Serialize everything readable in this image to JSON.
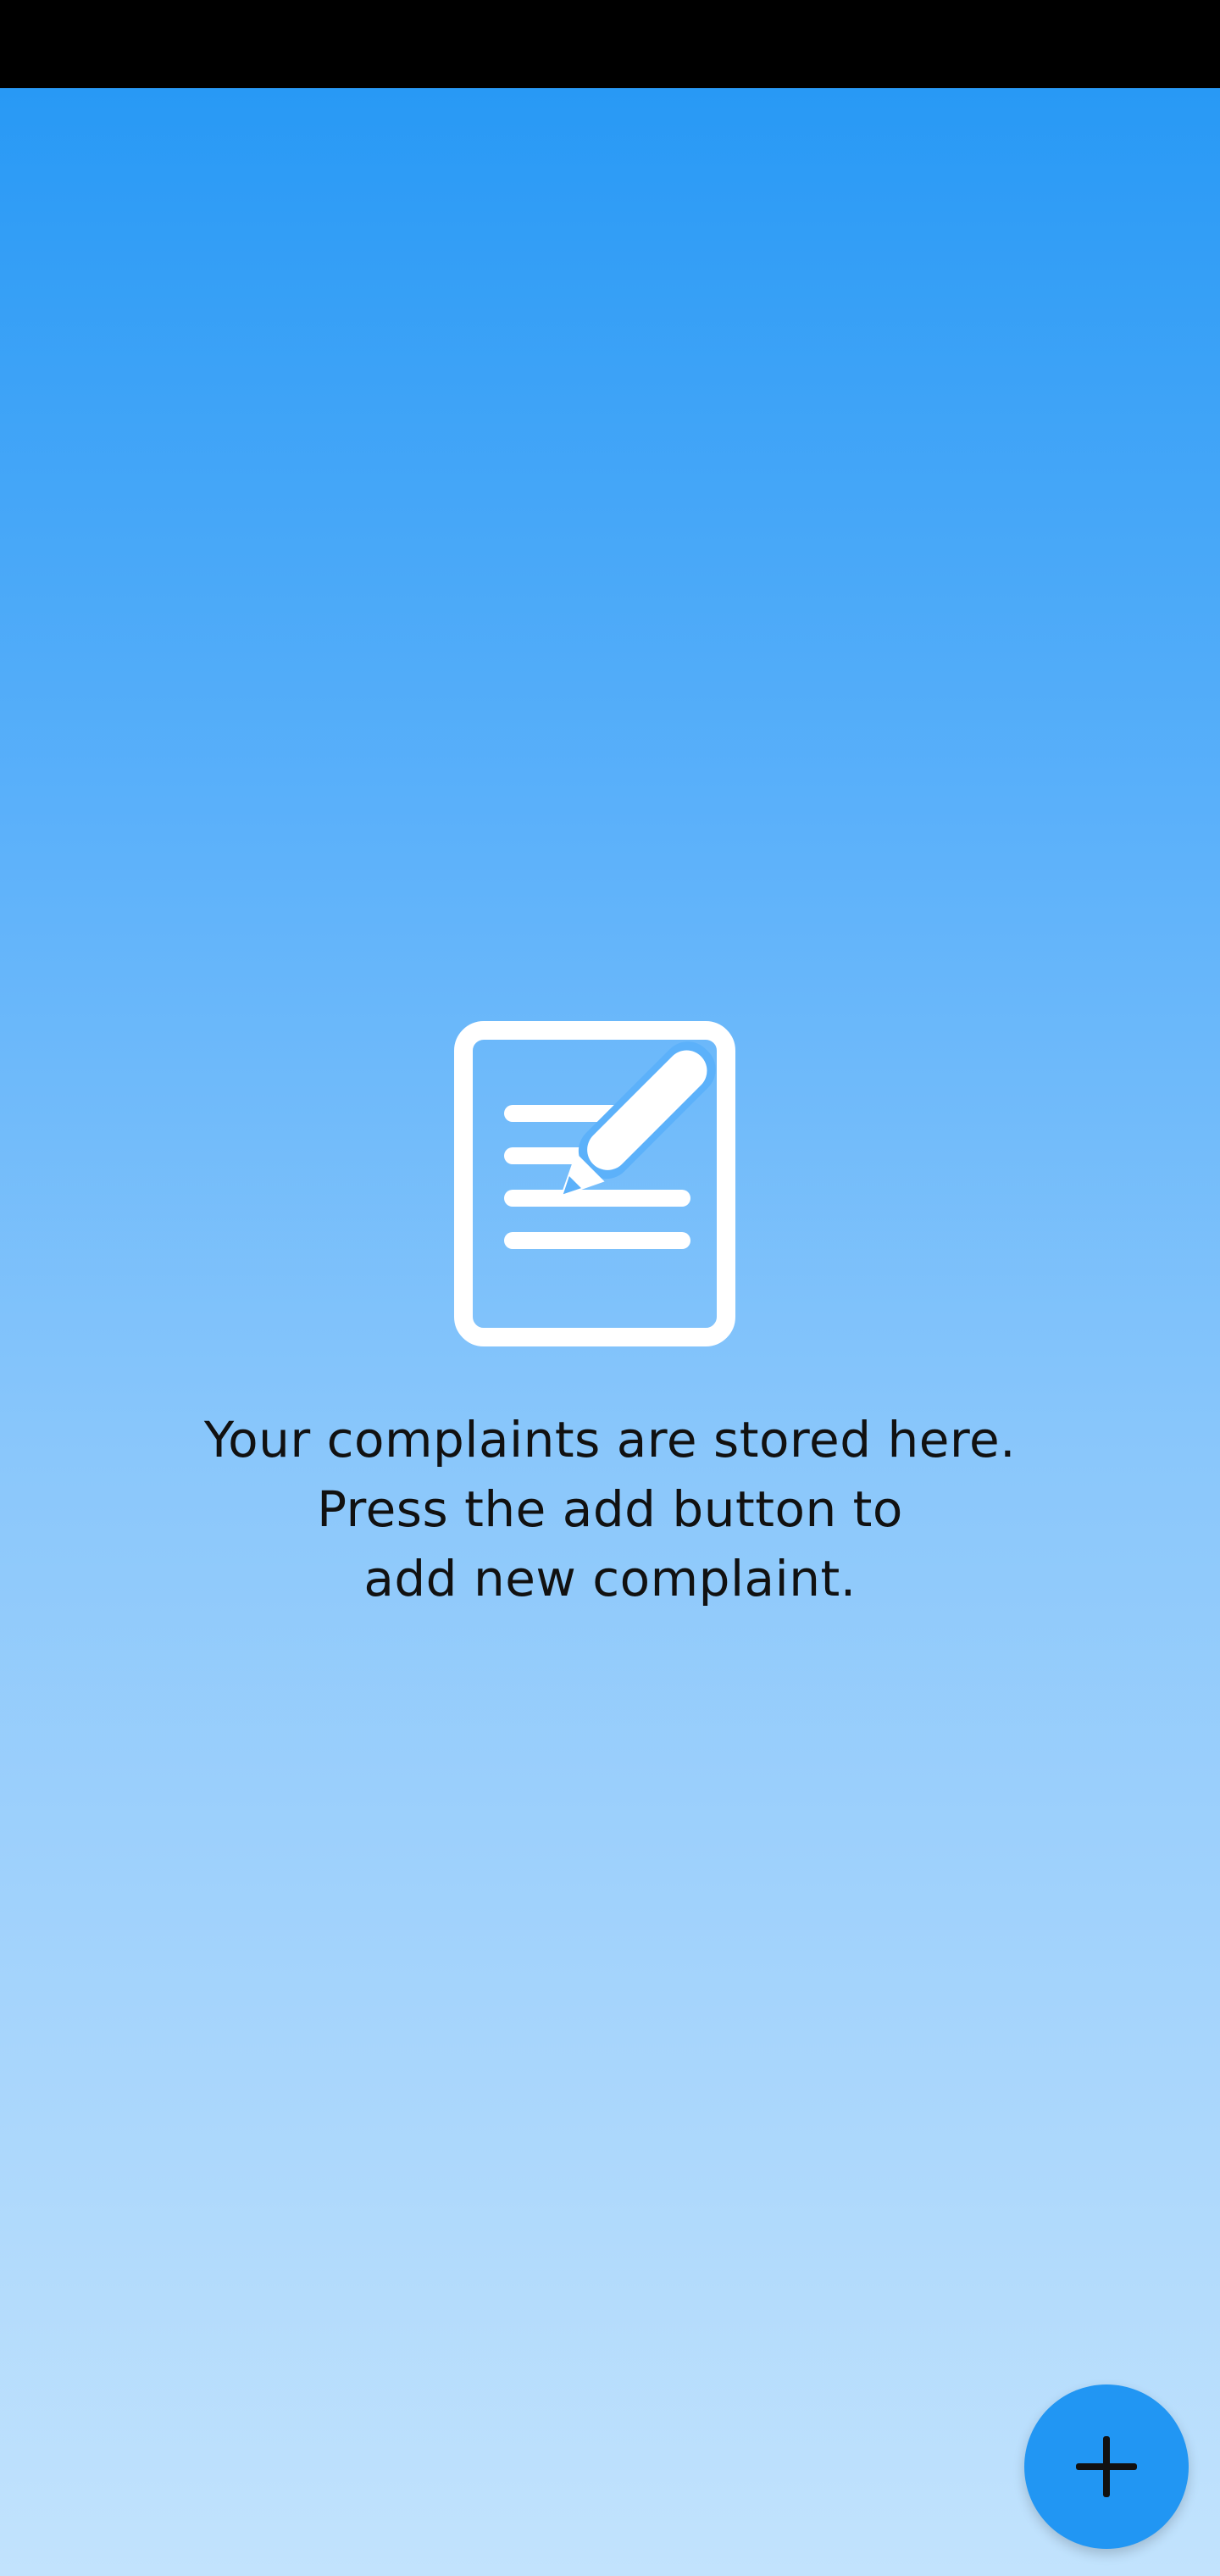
{
  "empty_state": {
    "icon": "document-edit-icon",
    "message_lines": [
      "Your complaints are stored here.",
      "Press the add button to",
      "add new complaint."
    ]
  },
  "fab": {
    "icon": "plus-icon"
  },
  "colors": {
    "status_bar": "#000000",
    "gradient_top": "#2899f5",
    "gradient_bottom": "#c2e3fd",
    "fab": "#2196f3",
    "icon": "#ffffff",
    "text": "#111111"
  }
}
